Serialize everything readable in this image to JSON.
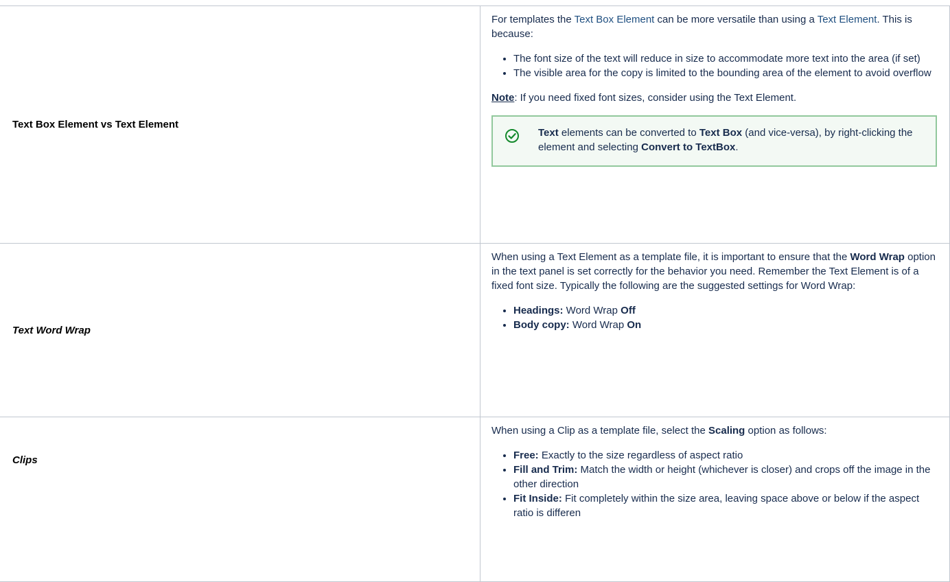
{
  "rows": [
    {
      "label": "Text Box Element vs Text Element",
      "intro": {
        "pre": "For templates the ",
        "link1": "Text Box Element",
        "mid": " can be more versatile than using a ",
        "link2": "Text Element",
        "post": ". This is because:"
      },
      "bullets": [
        "The font size of the text will reduce in size to accommodate more text into the area (if set)",
        "The visible area for the copy is limited to the bounding area of the element to avoid overflow"
      ],
      "note": {
        "label": "Note",
        "text": ": If you need fixed font sizes, consider using the Text Element."
      },
      "tip": {
        "icon": "check-circle-icon",
        "b1": "Text",
        "t1": " elements can be converted to ",
        "b2": "Text Box",
        "t2": " (and vice-versa), by right-clicking the element and selecting ",
        "b3": "Convert to TextBox",
        "t3": "."
      }
    },
    {
      "label": "Text Word Wrap",
      "intro": {
        "pre": "When using a Text Element as a template file, it is important to ensure that the ",
        "bold": "Word Wrap",
        "post": " option in the text panel is set correctly for the behavior you need. Remember the Text Element is of a fixed font size. Typically the following are the suggested settings for Word Wrap:"
      },
      "bullets": [
        {
          "label": "Headings:",
          "text": " Word Wrap ",
          "value": "Off"
        },
        {
          "label": "Body copy:",
          "text": " Word Wrap ",
          "value": "On"
        }
      ]
    },
    {
      "label": "Clips",
      "intro": {
        "pre": "When using a Clip as a template file, select the ",
        "bold": "Scaling",
        "post": " option as follows:"
      },
      "bullets": [
        {
          "label": "Free:",
          "text": " Exactly to the size regardless of aspect ratio"
        },
        {
          "label": "Fill and Trim:",
          "text": " Match the width or height (whichever is closer) and crops off the image in the other direction"
        },
        {
          "label": "Fit Inside:",
          "text": " Fit completely within the size area, leaving space above or below if the aspect ratio is differen"
        }
      ]
    }
  ],
  "colors": {
    "link": "#205081",
    "tip_border": "#91c89c",
    "tip_background": "#f3f9f4",
    "tip_icon": "#14892c",
    "table_border": "#c1c7d0"
  }
}
